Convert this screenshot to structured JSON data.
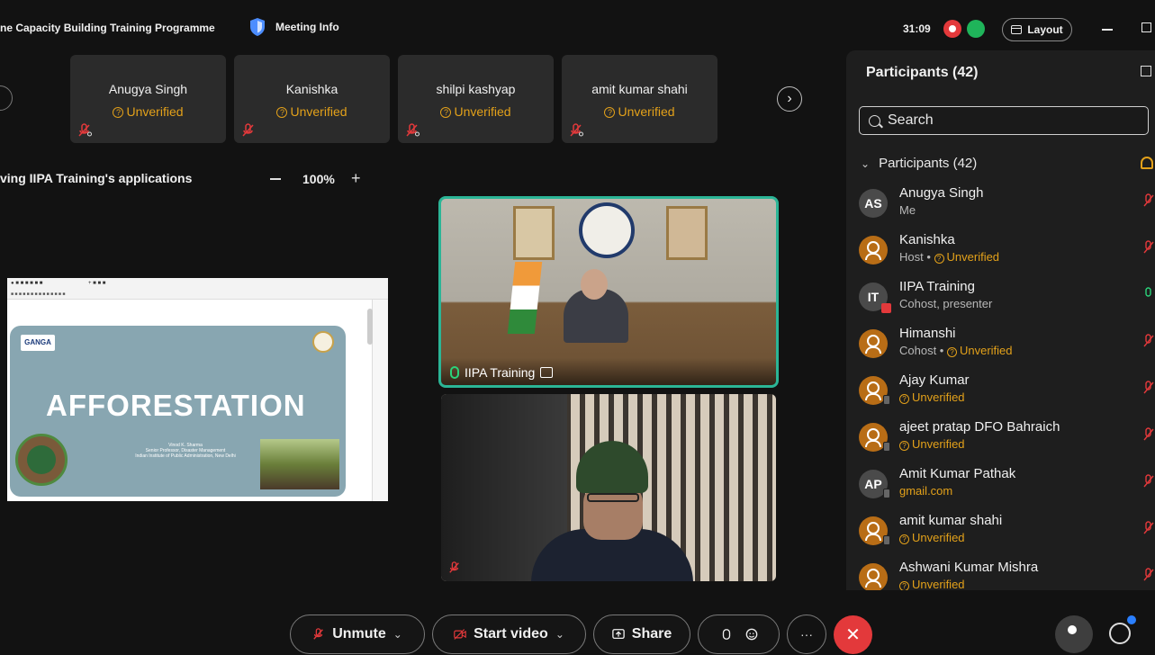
{
  "top_bar": {
    "title": "ne Capacity Building Training Programme",
    "meeting_info": "Meeting Info",
    "timer": "31:09",
    "layout_label": "Layout"
  },
  "tiles": [
    {
      "name": "Anugya Singh",
      "status": "Unverified"
    },
    {
      "name": "Kanishka",
      "status": "Unverified"
    },
    {
      "name": "shilpi kashyap",
      "status": "Unverified"
    },
    {
      "name": "amit kumar shahi",
      "status": "Unverified"
    }
  ],
  "sharing": {
    "label": "ving IIPA Training's applications",
    "zoom": "100%"
  },
  "shared_screen": {
    "logo_text": "GANGA",
    "slide_title": "AFFORESTATION",
    "credits_1": "Vinod K. Sharma",
    "credits_2": "Senior Professor, Disaster Management",
    "credits_3": "Indian Institute of Public Administration, New Delhi"
  },
  "videos": {
    "main_name": "IIPA Training"
  },
  "participants_panel": {
    "title": "Participants (42)",
    "search_placeholder": "Search",
    "group_label": "Participants (42)",
    "list": [
      {
        "initials": "AS",
        "name": "Anugya Singh",
        "role": "Me",
        "status": ""
      },
      {
        "initials": "",
        "name": "Kanishka",
        "role": "Host • ",
        "status": "Unverified"
      },
      {
        "initials": "IT",
        "name": "IIPA Training",
        "role": "Cohost, presenter",
        "status": ""
      },
      {
        "initials": "",
        "name": "Himanshi",
        "role": "Cohost • ",
        "status": "Unverified"
      },
      {
        "initials": "",
        "name": "Ajay Kumar",
        "role": "",
        "status": "Unverified"
      },
      {
        "initials": "",
        "name": "ajeet pratap DFO Bahraich",
        "role": "",
        "status": "Unverified"
      },
      {
        "initials": "AP",
        "name": "Amit Kumar Pathak",
        "role": "",
        "status": "gmail.com"
      },
      {
        "initials": "",
        "name": "amit kumar shahi",
        "role": "",
        "status": "Unverified"
      },
      {
        "initials": "",
        "name": "Ashwani Kumar Mishra",
        "role": "",
        "status": "Unverified"
      }
    ]
  },
  "controls": {
    "unmute": "Unmute",
    "start_video": "Start video",
    "share": "Share",
    "more": "···",
    "end": "✕"
  },
  "colors": {
    "accent_green": "#2bb596",
    "unverified": "#e3a11a",
    "end_red": "#e3393b"
  },
  "icons": [
    "shield-icon",
    "record-icon",
    "layout-icon",
    "minimize-icon",
    "restore-icon",
    "chevron-right-icon",
    "mic-off-icon",
    "search-icon",
    "popout-icon",
    "video-off-icon",
    "share-icon",
    "hand-icon",
    "emoji-icon",
    "people-icon",
    "chat-icon"
  ]
}
